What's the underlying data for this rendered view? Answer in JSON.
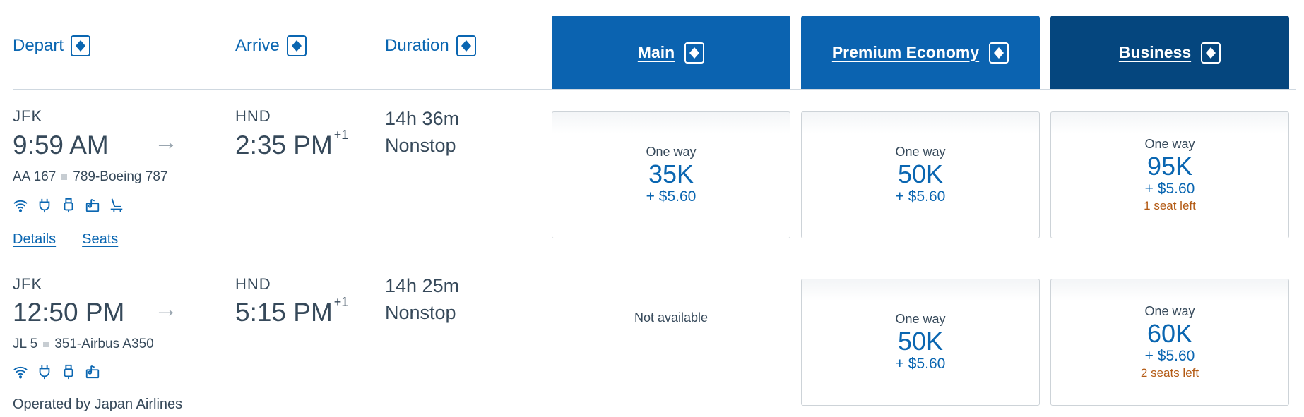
{
  "columns": {
    "depart": "Depart",
    "arrive": "Arrive",
    "duration": "Duration"
  },
  "cabins": [
    {
      "label": "Main",
      "color": "#0b63b0"
    },
    {
      "label": "Premium Economy",
      "color": "#0b63b0"
    },
    {
      "label": "Business",
      "color": "#05467e"
    }
  ],
  "flights": [
    {
      "origin": "JFK",
      "depart_time": "9:59 AM",
      "destination": "HND",
      "arrive_time": "2:35 PM",
      "day_offset": "+1",
      "flight_number": "AA 167",
      "aircraft": "789-Boeing 787",
      "duration": "14h 36m",
      "stops": "Nonstop",
      "amenities": [
        "wifi-icon",
        "power-outlet-icon",
        "usb-icon",
        "entertainment-icon",
        "lie-flat-seat-icon"
      ],
      "details_link": "Details",
      "seats_link": "Seats",
      "fares": {
        "main": {
          "label": "One way",
          "miles": "35K",
          "fee": "+ $5.60"
        },
        "premium": {
          "label": "One way",
          "miles": "50K",
          "fee": "+ $5.60"
        },
        "business": {
          "label": "One way",
          "miles": "95K",
          "fee": "+ $5.60",
          "seats_left": "1 seat left"
        }
      }
    },
    {
      "origin": "JFK",
      "depart_time": "12:50 PM",
      "destination": "HND",
      "arrive_time": "5:15 PM",
      "day_offset": "+1",
      "flight_number": "JL 5",
      "aircraft": "351-Airbus A350",
      "duration": "14h 25m",
      "stops": "Nonstop",
      "amenities": [
        "wifi-icon",
        "power-outlet-icon",
        "usb-icon",
        "entertainment-icon"
      ],
      "operated_by": "Operated by Japan Airlines",
      "fares": {
        "main": {
          "not_available": "Not available"
        },
        "premium": {
          "label": "One way",
          "miles": "50K",
          "fee": "+ $5.60"
        },
        "business": {
          "label": "One way",
          "miles": "60K",
          "fee": "+ $5.60",
          "seats_left": "2 seats left"
        }
      }
    }
  ]
}
